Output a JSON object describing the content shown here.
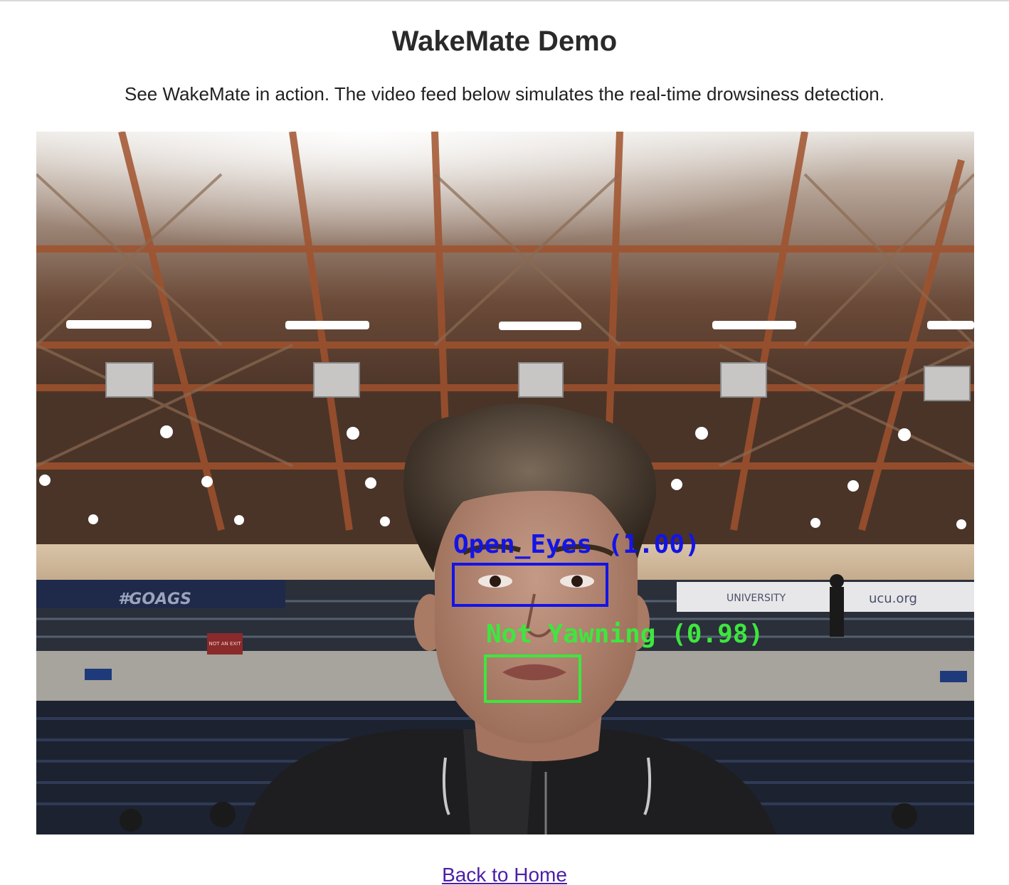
{
  "header": {
    "title": "WakeMate Demo",
    "description": "See WakeMate in action. The video feed below simulates the real-time drowsiness detection."
  },
  "video": {
    "detections": [
      {
        "label": "Open_Eyes (1.00)",
        "color": "#1414e6"
      },
      {
        "label": "Not Yawning (0.98)",
        "color": "#3ee63e"
      }
    ],
    "scene_signs": {
      "banner_left": "#GOAGS",
      "banner_right_1": "UNIVERSITY",
      "banner_right_2": "ucu.org",
      "exit_sign": "NOT AN EXIT"
    }
  },
  "footer": {
    "back_link": "Back to Home"
  }
}
